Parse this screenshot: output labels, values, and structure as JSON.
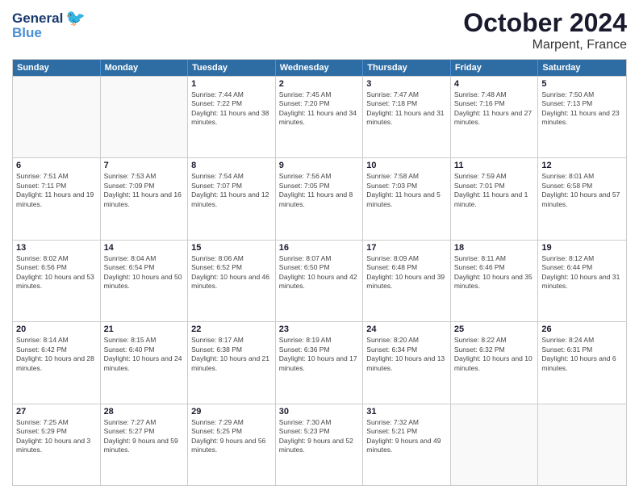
{
  "header": {
    "logo_general": "General",
    "logo_blue": "Blue",
    "title": "October 2024",
    "subtitle": "Marpent, France"
  },
  "calendar": {
    "days_of_week": [
      "Sunday",
      "Monday",
      "Tuesday",
      "Wednesday",
      "Thursday",
      "Friday",
      "Saturday"
    ],
    "rows": [
      [
        {
          "day": "",
          "info": ""
        },
        {
          "day": "",
          "info": ""
        },
        {
          "day": "1",
          "info": "Sunrise: 7:44 AM\nSunset: 7:22 PM\nDaylight: 11 hours and 38 minutes."
        },
        {
          "day": "2",
          "info": "Sunrise: 7:45 AM\nSunset: 7:20 PM\nDaylight: 11 hours and 34 minutes."
        },
        {
          "day": "3",
          "info": "Sunrise: 7:47 AM\nSunset: 7:18 PM\nDaylight: 11 hours and 31 minutes."
        },
        {
          "day": "4",
          "info": "Sunrise: 7:48 AM\nSunset: 7:16 PM\nDaylight: 11 hours and 27 minutes."
        },
        {
          "day": "5",
          "info": "Sunrise: 7:50 AM\nSunset: 7:13 PM\nDaylight: 11 hours and 23 minutes."
        }
      ],
      [
        {
          "day": "6",
          "info": "Sunrise: 7:51 AM\nSunset: 7:11 PM\nDaylight: 11 hours and 19 minutes."
        },
        {
          "day": "7",
          "info": "Sunrise: 7:53 AM\nSunset: 7:09 PM\nDaylight: 11 hours and 16 minutes."
        },
        {
          "day": "8",
          "info": "Sunrise: 7:54 AM\nSunset: 7:07 PM\nDaylight: 11 hours and 12 minutes."
        },
        {
          "day": "9",
          "info": "Sunrise: 7:56 AM\nSunset: 7:05 PM\nDaylight: 11 hours and 8 minutes."
        },
        {
          "day": "10",
          "info": "Sunrise: 7:58 AM\nSunset: 7:03 PM\nDaylight: 11 hours and 5 minutes."
        },
        {
          "day": "11",
          "info": "Sunrise: 7:59 AM\nSunset: 7:01 PM\nDaylight: 11 hours and 1 minute."
        },
        {
          "day": "12",
          "info": "Sunrise: 8:01 AM\nSunset: 6:58 PM\nDaylight: 10 hours and 57 minutes."
        }
      ],
      [
        {
          "day": "13",
          "info": "Sunrise: 8:02 AM\nSunset: 6:56 PM\nDaylight: 10 hours and 53 minutes."
        },
        {
          "day": "14",
          "info": "Sunrise: 8:04 AM\nSunset: 6:54 PM\nDaylight: 10 hours and 50 minutes."
        },
        {
          "day": "15",
          "info": "Sunrise: 8:06 AM\nSunset: 6:52 PM\nDaylight: 10 hours and 46 minutes."
        },
        {
          "day": "16",
          "info": "Sunrise: 8:07 AM\nSunset: 6:50 PM\nDaylight: 10 hours and 42 minutes."
        },
        {
          "day": "17",
          "info": "Sunrise: 8:09 AM\nSunset: 6:48 PM\nDaylight: 10 hours and 39 minutes."
        },
        {
          "day": "18",
          "info": "Sunrise: 8:11 AM\nSunset: 6:46 PM\nDaylight: 10 hours and 35 minutes."
        },
        {
          "day": "19",
          "info": "Sunrise: 8:12 AM\nSunset: 6:44 PM\nDaylight: 10 hours and 31 minutes."
        }
      ],
      [
        {
          "day": "20",
          "info": "Sunrise: 8:14 AM\nSunset: 6:42 PM\nDaylight: 10 hours and 28 minutes."
        },
        {
          "day": "21",
          "info": "Sunrise: 8:15 AM\nSunset: 6:40 PM\nDaylight: 10 hours and 24 minutes."
        },
        {
          "day": "22",
          "info": "Sunrise: 8:17 AM\nSunset: 6:38 PM\nDaylight: 10 hours and 21 minutes."
        },
        {
          "day": "23",
          "info": "Sunrise: 8:19 AM\nSunset: 6:36 PM\nDaylight: 10 hours and 17 minutes."
        },
        {
          "day": "24",
          "info": "Sunrise: 8:20 AM\nSunset: 6:34 PM\nDaylight: 10 hours and 13 minutes."
        },
        {
          "day": "25",
          "info": "Sunrise: 8:22 AM\nSunset: 6:32 PM\nDaylight: 10 hours and 10 minutes."
        },
        {
          "day": "26",
          "info": "Sunrise: 8:24 AM\nSunset: 6:31 PM\nDaylight: 10 hours and 6 minutes."
        }
      ],
      [
        {
          "day": "27",
          "info": "Sunrise: 7:25 AM\nSunset: 5:29 PM\nDaylight: 10 hours and 3 minutes."
        },
        {
          "day": "28",
          "info": "Sunrise: 7:27 AM\nSunset: 5:27 PM\nDaylight: 9 hours and 59 minutes."
        },
        {
          "day": "29",
          "info": "Sunrise: 7:29 AM\nSunset: 5:25 PM\nDaylight: 9 hours and 56 minutes."
        },
        {
          "day": "30",
          "info": "Sunrise: 7:30 AM\nSunset: 5:23 PM\nDaylight: 9 hours and 52 minutes."
        },
        {
          "day": "31",
          "info": "Sunrise: 7:32 AM\nSunset: 5:21 PM\nDaylight: 9 hours and 49 minutes."
        },
        {
          "day": "",
          "info": ""
        },
        {
          "day": "",
          "info": ""
        }
      ]
    ]
  }
}
